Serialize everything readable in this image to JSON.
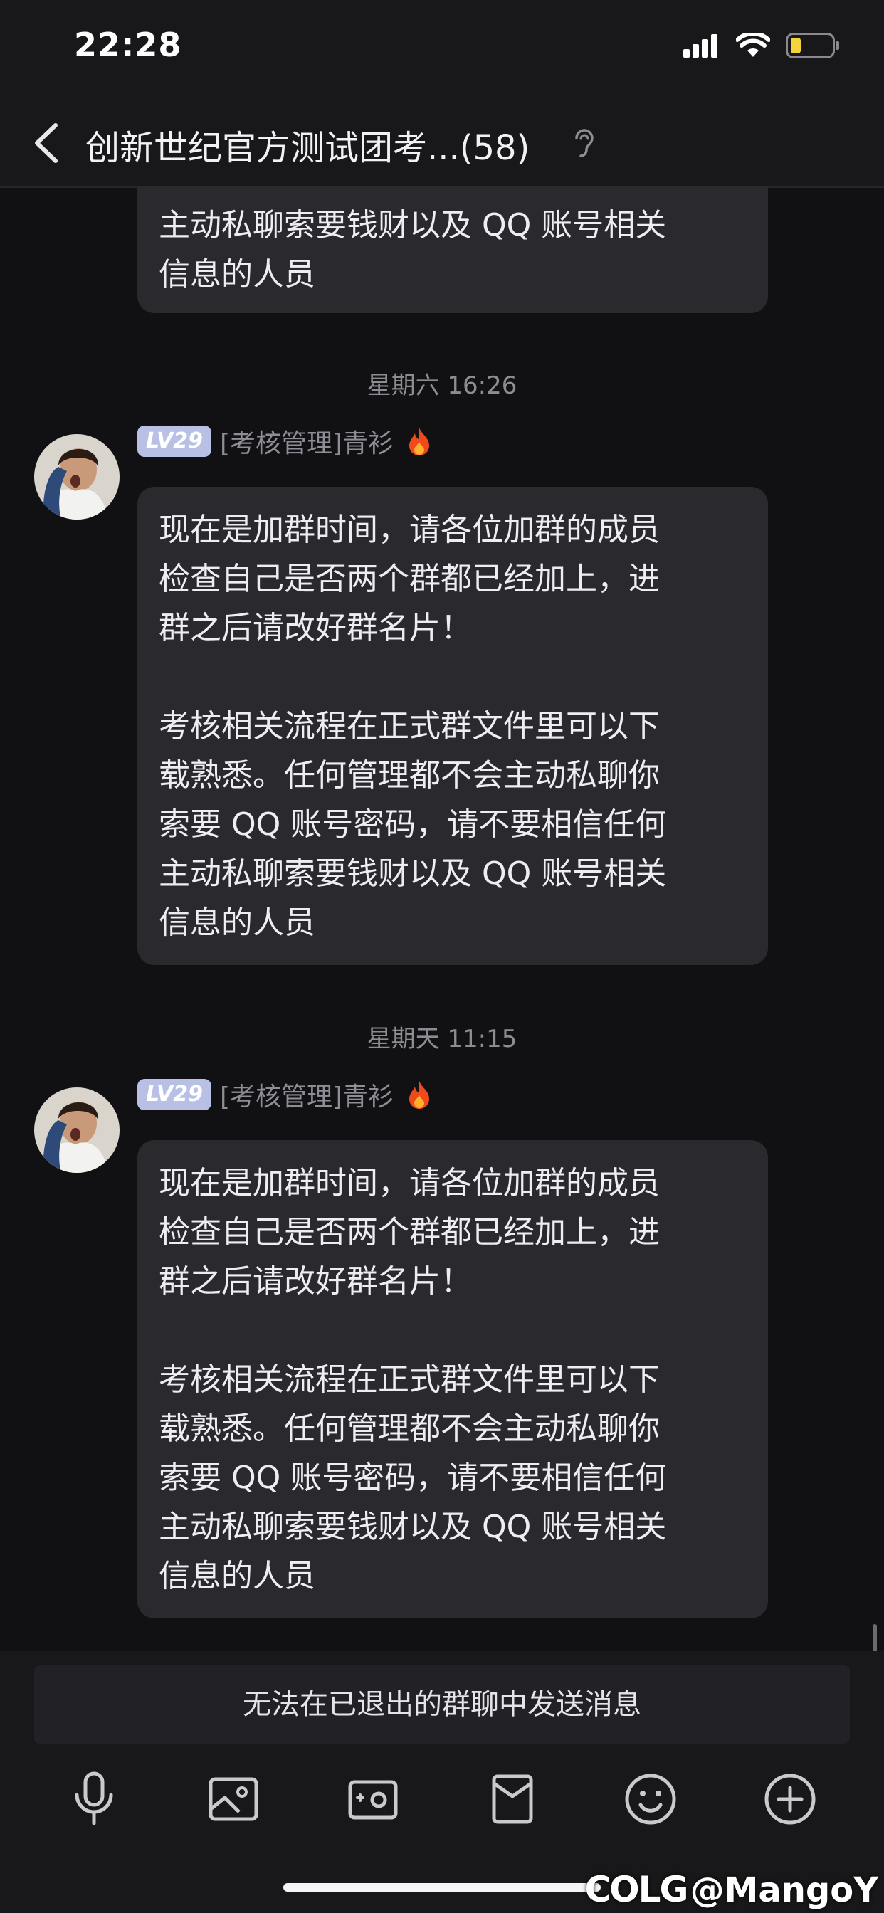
{
  "status_bar": {
    "time": "22:28"
  },
  "header": {
    "title": "创新世纪官方测试团考...(58)"
  },
  "messages": [
    {
      "partial_text": "主动私聊索要钱财以及 QQ 账号相关\n信息的人员"
    },
    {
      "timestamp": "星期六 16:26",
      "level": "LV29",
      "sender": "[考核管理]青衫",
      "text": "现在是加群时间，请各位加群的成员\n检查自己是否两个群都已经加上，进\n群之后请改好群名片！\n\n考核相关流程在正式群文件里可以下\n载熟悉。任何管理都不会主动私聊你\n索要 QQ 账号密码，请不要相信任何\n主动私聊索要钱财以及 QQ 账号相关\n信息的人员"
    },
    {
      "timestamp": "星期天 11:15",
      "level": "LV29",
      "sender": "[考核管理]青衫",
      "text": "现在是加群时间，请各位加群的成员\n检查自己是否两个群都已经加上，进\n群之后请改好群名片！\n\n考核相关流程在正式群文件里可以下\n载熟悉。任何管理都不会主动私聊你\n索要 QQ 账号密码，请不要相信任何\n主动私聊索要钱财以及 QQ 账号相关\n信息的人员"
    }
  ],
  "input_area": {
    "notice": "无法在已退出的群聊中发送消息"
  },
  "toolbar": {
    "icons": [
      "microphone-icon",
      "image-icon",
      "camera-icon",
      "red-packet-icon",
      "emoji-icon",
      "plus-icon"
    ]
  },
  "watermark": {
    "logo": "COLG",
    "handle": "@MangoY"
  },
  "colors": {
    "background": "#111113",
    "bubble": "#2a2a2e",
    "level_badge": "#b8c0e6",
    "battery": "#f2d43c"
  }
}
